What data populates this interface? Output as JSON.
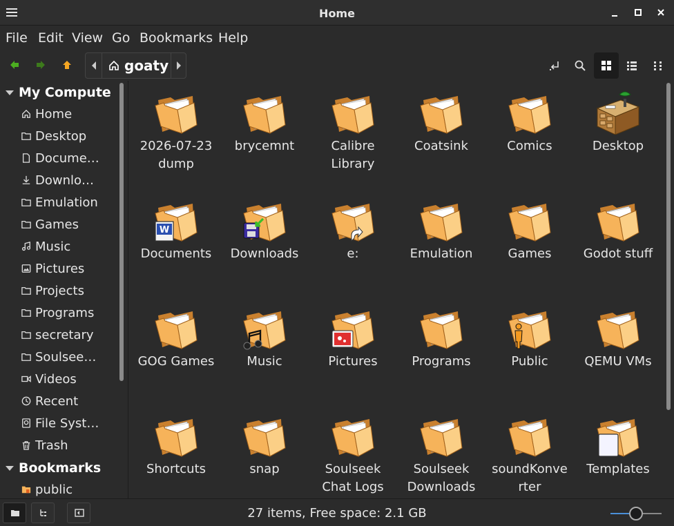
{
  "window": {
    "title": "Home"
  },
  "menubar": [
    "File",
    "Edit",
    "View",
    "Go",
    "Bookmarks",
    "Help"
  ],
  "path": {
    "current": "goaty"
  },
  "sidebar": {
    "computer_header": "My Compute",
    "computer_items": [
      {
        "label": "Home",
        "icon": "home-icon"
      },
      {
        "label": "Desktop",
        "icon": "folder-icon"
      },
      {
        "label": "Docume…",
        "icon": "document-icon"
      },
      {
        "label": "Downlo…",
        "icon": "download-icon"
      },
      {
        "label": "Emulation",
        "icon": "folder-icon"
      },
      {
        "label": "Games",
        "icon": "folder-icon"
      },
      {
        "label": "Music",
        "icon": "music-icon"
      },
      {
        "label": "Pictures",
        "icon": "picture-icon"
      },
      {
        "label": "Projects",
        "icon": "folder-icon"
      },
      {
        "label": "Programs",
        "icon": "folder-icon"
      },
      {
        "label": "secretary",
        "icon": "folder-icon"
      },
      {
        "label": "Soulsee…",
        "icon": "folder-icon"
      },
      {
        "label": "Videos",
        "icon": "video-icon"
      },
      {
        "label": "Recent",
        "icon": "clock-icon"
      },
      {
        "label": "File Syst…",
        "icon": "drive-icon"
      },
      {
        "label": "Trash",
        "icon": "trash-icon"
      }
    ],
    "bookmarks_header": "Bookmarks",
    "bookmark_items": [
      {
        "label": "public",
        "icon": "folder-public-icon"
      }
    ]
  },
  "files": [
    {
      "l1": "2026-07-23",
      "l2": "dump",
      "emblem": ""
    },
    {
      "l1": "brycemnt",
      "l2": "",
      "emblem": ""
    },
    {
      "l1": "Calibre",
      "l2": "Library",
      "emblem": ""
    },
    {
      "l1": "Coatsink",
      "l2": "",
      "emblem": ""
    },
    {
      "l1": "Comics",
      "l2": "",
      "emblem": ""
    },
    {
      "l1": "Desktop",
      "l2": "",
      "emblem": "desktop"
    },
    {
      "l1": "Documents",
      "l2": "",
      "emblem": "word"
    },
    {
      "l1": "Downloads",
      "l2": "",
      "emblem": "download"
    },
    {
      "l1": "e:",
      "l2": "",
      "emblem": "link"
    },
    {
      "l1": "Emulation",
      "l2": "",
      "emblem": ""
    },
    {
      "l1": "Games",
      "l2": "",
      "emblem": ""
    },
    {
      "l1": "Godot stuff",
      "l2": "",
      "emblem": ""
    },
    {
      "l1": "GOG Games",
      "l2": "",
      "emblem": ""
    },
    {
      "l1": "Music",
      "l2": "",
      "emblem": "music"
    },
    {
      "l1": "Pictures",
      "l2": "",
      "emblem": "pictures"
    },
    {
      "l1": "Programs",
      "l2": "",
      "emblem": ""
    },
    {
      "l1": "Public",
      "l2": "",
      "emblem": "public"
    },
    {
      "l1": "QEMU VMs",
      "l2": "",
      "emblem": ""
    },
    {
      "l1": "Shortcuts",
      "l2": "",
      "emblem": ""
    },
    {
      "l1": "snap",
      "l2": "",
      "emblem": ""
    },
    {
      "l1": "Soulseek",
      "l2": "Chat Logs",
      "emblem": ""
    },
    {
      "l1": "Soulseek",
      "l2": "Downloads",
      "emblem": ""
    },
    {
      "l1": "soundKonve",
      "l2": "rter",
      "emblem": ""
    },
    {
      "l1": "Templates",
      "l2": "",
      "emblem": "templates"
    }
  ],
  "status": {
    "text": "27 items, Free space: 2.1 GB",
    "zoom_level": 0.5
  },
  "colors": {
    "accent": "#4a90d9",
    "back_arrow": "#4caf20",
    "up_arrow": "#f5a623",
    "folder": "#f6b35a"
  }
}
